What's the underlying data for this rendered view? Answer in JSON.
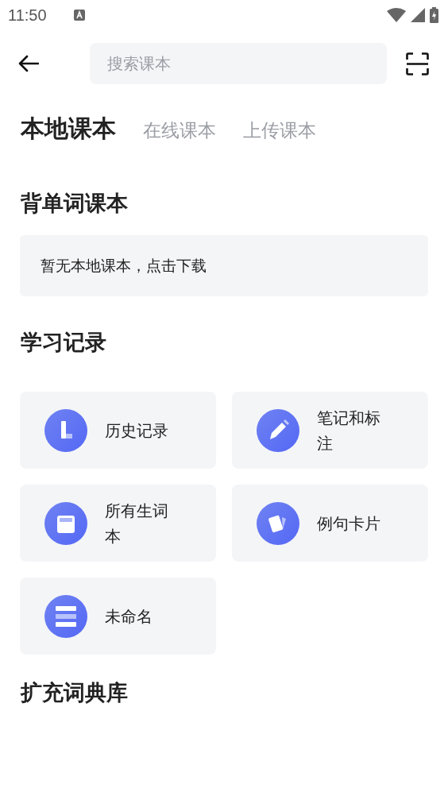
{
  "status_bar": {
    "time": "11:50"
  },
  "search": {
    "placeholder": "搜索课本"
  },
  "tabs": [
    {
      "label": "本地课本",
      "selected": true
    },
    {
      "label": "在线课本",
      "selected": false
    },
    {
      "label": "上传课本",
      "selected": false
    }
  ],
  "sections": [
    {
      "title": "背单词课本",
      "empty_message": "暂无本地课本，点击下载"
    },
    {
      "title": "学习记录",
      "items": [
        {
          "kind": "history",
          "label": "历史记录"
        },
        {
          "kind": "note",
          "label": "笔记和标注"
        },
        {
          "kind": "vocab",
          "label": "所有生词本"
        },
        {
          "kind": "card",
          "label": "例句卡片"
        },
        {
          "kind": "list",
          "label": "未命名"
        }
      ]
    },
    {
      "title": "扩充词典库"
    }
  ]
}
